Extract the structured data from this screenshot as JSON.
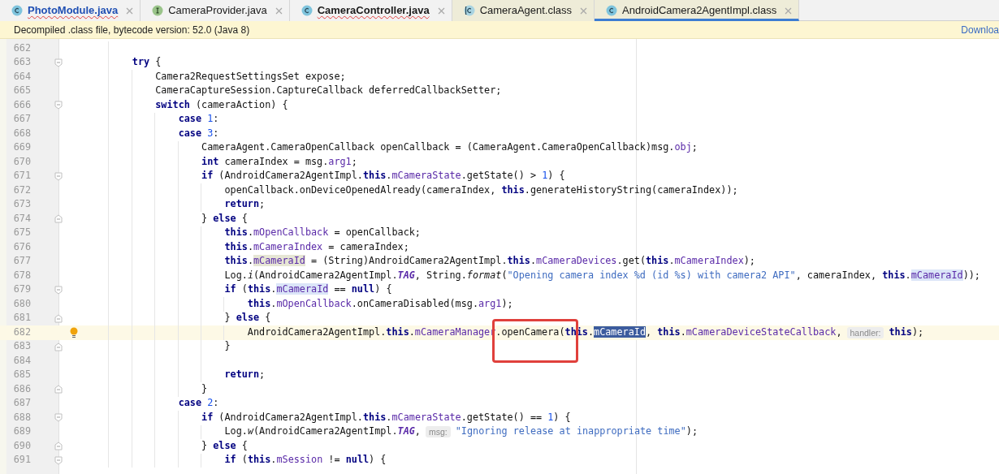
{
  "tabs": [
    {
      "label": "PhotoModule.java",
      "kind": "class",
      "selected": false,
      "modified": true,
      "error": true,
      "library": false
    },
    {
      "label": "CameraProvider.java",
      "kind": "interface",
      "selected": false,
      "modified": false,
      "error": false,
      "library": false
    },
    {
      "label": "CameraController.java",
      "kind": "class",
      "selected": false,
      "modified": false,
      "error": true,
      "library": false
    },
    {
      "label": "CameraAgent.class",
      "kind": "class_file",
      "selected": false,
      "modified": false,
      "error": false,
      "library": true
    },
    {
      "label": "AndroidCamera2AgentImpl.class",
      "kind": "class",
      "selected": true,
      "modified": false,
      "error": false,
      "library": true
    }
  ],
  "banner": {
    "message": "Decompiled .class file, bytecode version: 52.0 (Java 8)",
    "link": "Downloa"
  },
  "editor": {
    "lines": [
      {
        "number": "662",
        "current": false
      },
      {
        "number": "663",
        "current": false,
        "fold": {
          "kind": "start"
        },
        "tokens": [
          {
            "kind": "keyword",
            "text": "        try"
          },
          {
            "kind": "plain",
            "text": " {"
          }
        ]
      },
      {
        "number": "664",
        "current": false,
        "tokens": [
          {
            "kind": "plain",
            "text": "            Camera2RequestSettingsSet expose;"
          }
        ]
      },
      {
        "number": "665",
        "current": false,
        "tokens": [
          {
            "kind": "plain",
            "text": "            CameraCaptureSession.CaptureCallback deferredCallbackSetter;"
          }
        ]
      },
      {
        "number": "666",
        "current": false,
        "fold": {
          "kind": "start"
        },
        "tokens": [
          {
            "kind": "keyword",
            "text": "            switch"
          },
          {
            "kind": "plain",
            "text": " (cameraAction) {"
          }
        ]
      },
      {
        "number": "667",
        "current": false,
        "tokens": [
          {
            "kind": "keyword",
            "text": "                case"
          },
          {
            "kind": "number",
            "text": " 1"
          },
          {
            "kind": "plain",
            "text": ":"
          }
        ]
      },
      {
        "number": "668",
        "current": false,
        "tokens": [
          {
            "kind": "keyword",
            "text": "                case"
          },
          {
            "kind": "number",
            "text": " 3"
          },
          {
            "kind": "plain",
            "text": ":"
          }
        ]
      },
      {
        "number": "669",
        "current": false,
        "tokens": [
          {
            "kind": "plain",
            "text": "                    CameraAgent.CameraOpenCallback openCallback = (CameraAgent.CameraOpenCallback)msg."
          },
          {
            "kind": "field",
            "text": "obj"
          },
          {
            "kind": "plain",
            "text": ";"
          }
        ]
      },
      {
        "number": "670",
        "current": false,
        "tokens": [
          {
            "kind": "keyword",
            "text": "                    int"
          },
          {
            "kind": "plain",
            "text": " cameraIndex = msg."
          },
          {
            "kind": "field",
            "text": "arg1"
          },
          {
            "kind": "plain",
            "text": ";"
          }
        ]
      },
      {
        "number": "671",
        "current": false,
        "fold": {
          "kind": "start"
        },
        "tokens": [
          {
            "kind": "keyword",
            "text": "                    if"
          },
          {
            "kind": "plain",
            "text": " (AndroidCamera2AgentImpl."
          },
          {
            "kind": "keyword",
            "text": "this"
          },
          {
            "kind": "plain",
            "text": "."
          },
          {
            "kind": "field",
            "text": "mCameraState"
          },
          {
            "kind": "plain",
            "text": ".getState() > "
          },
          {
            "kind": "number",
            "text": "1"
          },
          {
            "kind": "plain",
            "text": ") {"
          }
        ]
      },
      {
        "number": "672",
        "current": false,
        "tokens": [
          {
            "kind": "plain",
            "text": "                        openCallback.onDeviceOpenedAlready(cameraIndex, "
          },
          {
            "kind": "keyword",
            "text": "this"
          },
          {
            "kind": "plain",
            "text": ".generateHistoryString(cameraIndex));"
          }
        ]
      },
      {
        "number": "673",
        "current": false,
        "tokens": [
          {
            "kind": "keyword",
            "text": "                        return"
          },
          {
            "kind": "plain",
            "text": ";"
          }
        ]
      },
      {
        "number": "674",
        "current": false,
        "fold": {
          "kind": "end"
        },
        "tokens": [
          {
            "kind": "plain",
            "text": "                    } "
          },
          {
            "kind": "keyword",
            "text": "else"
          },
          {
            "kind": "plain",
            "text": " {"
          }
        ]
      },
      {
        "number": "675",
        "current": false,
        "tokens": [
          {
            "kind": "keyword",
            "text": "                        this"
          },
          {
            "kind": "plain",
            "text": "."
          },
          {
            "kind": "field",
            "text": "mOpenCallback"
          },
          {
            "kind": "plain",
            "text": " = openCallback;"
          }
        ]
      },
      {
        "number": "676",
        "current": false,
        "tokens": [
          {
            "kind": "keyword",
            "text": "                        this"
          },
          {
            "kind": "plain",
            "text": "."
          },
          {
            "kind": "field",
            "text": "mCameraIndex"
          },
          {
            "kind": "plain",
            "text": " = cameraIndex;"
          }
        ]
      },
      {
        "number": "677",
        "current": false,
        "tokens": [
          {
            "kind": "keyword",
            "text": "                        this"
          },
          {
            "kind": "plain",
            "text": "."
          },
          {
            "kind": "field_write",
            "text": "mCameraId"
          },
          {
            "kind": "plain",
            "text": " = (String)AndroidCamera2AgentImpl."
          },
          {
            "kind": "keyword",
            "text": "this"
          },
          {
            "kind": "plain",
            "text": "."
          },
          {
            "kind": "field",
            "text": "mCameraDevices"
          },
          {
            "kind": "plain",
            "text": ".get("
          },
          {
            "kind": "keyword",
            "text": "this"
          },
          {
            "kind": "plain",
            "text": "."
          },
          {
            "kind": "field",
            "text": "mCameraIndex"
          },
          {
            "kind": "plain",
            "text": ");"
          }
        ]
      },
      {
        "number": "678",
        "current": false,
        "tokens": [
          {
            "kind": "plain",
            "text": "                        Log."
          },
          {
            "kind": "static_method",
            "text": "i"
          },
          {
            "kind": "plain",
            "text": "(AndroidCamera2AgentImpl."
          },
          {
            "kind": "static_field",
            "text": "TAG"
          },
          {
            "kind": "plain",
            "text": ", String."
          },
          {
            "kind": "static_method",
            "text": "format"
          },
          {
            "kind": "plain",
            "text": "("
          },
          {
            "kind": "string",
            "text": "\"Opening camera index %d (id %s) with camera2 API\""
          },
          {
            "kind": "plain",
            "text": ", cameraIndex, "
          },
          {
            "kind": "keyword",
            "text": "this"
          },
          {
            "kind": "plain",
            "text": "."
          },
          {
            "kind": "field_read",
            "text": "mCameraId"
          },
          {
            "kind": "plain",
            "text": "));"
          }
        ]
      },
      {
        "number": "679",
        "current": false,
        "fold": {
          "kind": "start"
        },
        "tokens": [
          {
            "kind": "keyword",
            "text": "                        if"
          },
          {
            "kind": "plain",
            "text": " ("
          },
          {
            "kind": "keyword",
            "text": "this"
          },
          {
            "kind": "plain",
            "text": "."
          },
          {
            "kind": "field_read",
            "text": "mCameraId"
          },
          {
            "kind": "plain",
            "text": " == "
          },
          {
            "kind": "keyword",
            "text": "null"
          },
          {
            "kind": "plain",
            "text": ") {"
          }
        ]
      },
      {
        "number": "680",
        "current": false,
        "tokens": [
          {
            "kind": "keyword",
            "text": "                            this"
          },
          {
            "kind": "plain",
            "text": "."
          },
          {
            "kind": "field",
            "text": "mOpenCallback"
          },
          {
            "kind": "plain",
            "text": ".onCameraDisabled(msg."
          },
          {
            "kind": "field",
            "text": "arg1"
          },
          {
            "kind": "plain",
            "text": ");"
          }
        ]
      },
      {
        "number": "681",
        "current": false,
        "fold": {
          "kind": "end"
        },
        "tokens": [
          {
            "kind": "plain",
            "text": "                        } "
          },
          {
            "kind": "keyword",
            "text": "else"
          },
          {
            "kind": "plain",
            "text": " {"
          }
        ]
      },
      {
        "number": "682",
        "current": true,
        "tokens": [
          {
            "kind": "plain",
            "text": "                            AndroidCamera2AgentImpl."
          },
          {
            "kind": "keyword",
            "text": "this"
          },
          {
            "kind": "plain",
            "text": "."
          },
          {
            "kind": "field",
            "text": "mCameraManager"
          },
          {
            "kind": "plain",
            "text": ".openCamera(",
            "annotated": true
          },
          {
            "kind": "keyword",
            "text": "this"
          },
          {
            "kind": "plain",
            "text": "."
          },
          {
            "kind": "field_selected",
            "text": "mCameraId"
          },
          {
            "kind": "plain",
            "text": ", "
          },
          {
            "kind": "keyword",
            "text": "this"
          },
          {
            "kind": "plain",
            "text": "."
          },
          {
            "kind": "field",
            "text": "mCameraDeviceStateCallback"
          },
          {
            "kind": "plain",
            "text": ","
          },
          {
            "kind": "hint",
            "text": "handler:"
          },
          {
            "kind": "keyword",
            "text": "this"
          },
          {
            "kind": "plain",
            "text": ");"
          }
        ]
      },
      {
        "number": "683",
        "current": false,
        "fold": {
          "kind": "end"
        },
        "tokens": [
          {
            "kind": "plain",
            "text": "                        }"
          }
        ]
      },
      {
        "number": "684",
        "current": false
      },
      {
        "number": "685",
        "current": false,
        "tokens": [
          {
            "kind": "keyword",
            "text": "                        return"
          },
          {
            "kind": "plain",
            "text": ";"
          }
        ]
      },
      {
        "number": "686",
        "current": false,
        "fold": {
          "kind": "end"
        },
        "tokens": [
          {
            "kind": "plain",
            "text": "                    }"
          }
        ]
      },
      {
        "number": "687",
        "current": false,
        "tokens": [
          {
            "kind": "keyword",
            "text": "                case"
          },
          {
            "kind": "number",
            "text": " 2"
          },
          {
            "kind": "plain",
            "text": ":"
          }
        ]
      },
      {
        "number": "688",
        "current": false,
        "fold": {
          "kind": "start"
        },
        "tokens": [
          {
            "kind": "keyword",
            "text": "                    if"
          },
          {
            "kind": "plain",
            "text": " (AndroidCamera2AgentImpl."
          },
          {
            "kind": "keyword",
            "text": "this"
          },
          {
            "kind": "plain",
            "text": "."
          },
          {
            "kind": "field",
            "text": "mCameraState"
          },
          {
            "kind": "plain",
            "text": ".getState() == "
          },
          {
            "kind": "number",
            "text": "1"
          },
          {
            "kind": "plain",
            "text": ") {"
          }
        ]
      },
      {
        "number": "689",
        "current": false,
        "tokens": [
          {
            "kind": "plain",
            "text": "                        Log."
          },
          {
            "kind": "static_method",
            "text": "w"
          },
          {
            "kind": "plain",
            "text": "(AndroidCamera2AgentImpl."
          },
          {
            "kind": "static_field",
            "text": "TAG"
          },
          {
            "kind": "plain",
            "text": ","
          },
          {
            "kind": "hint",
            "text": "msg:"
          },
          {
            "kind": "string",
            "text": "\"Ignoring release at inappropriate time\""
          },
          {
            "kind": "plain",
            "text": ");"
          }
        ]
      },
      {
        "number": "690",
        "current": false,
        "fold": {
          "kind": "end"
        },
        "tokens": [
          {
            "kind": "plain",
            "text": "                    } "
          },
          {
            "kind": "keyword",
            "text": "else"
          },
          {
            "kind": "plain",
            "text": " {"
          }
        ]
      },
      {
        "number": "691",
        "current": false,
        "fold": {
          "kind": "start"
        },
        "tokens": [
          {
            "kind": "keyword",
            "text": "                        if"
          },
          {
            "kind": "plain",
            "text": " ("
          },
          {
            "kind": "keyword",
            "text": "this"
          },
          {
            "kind": "plain",
            "text": "."
          },
          {
            "kind": "field",
            "text": "mSession"
          },
          {
            "kind": "plain",
            "text": " != "
          },
          {
            "kind": "keyword",
            "text": "null"
          },
          {
            "kind": "plain",
            "text": ") {"
          }
        ]
      }
    ]
  }
}
